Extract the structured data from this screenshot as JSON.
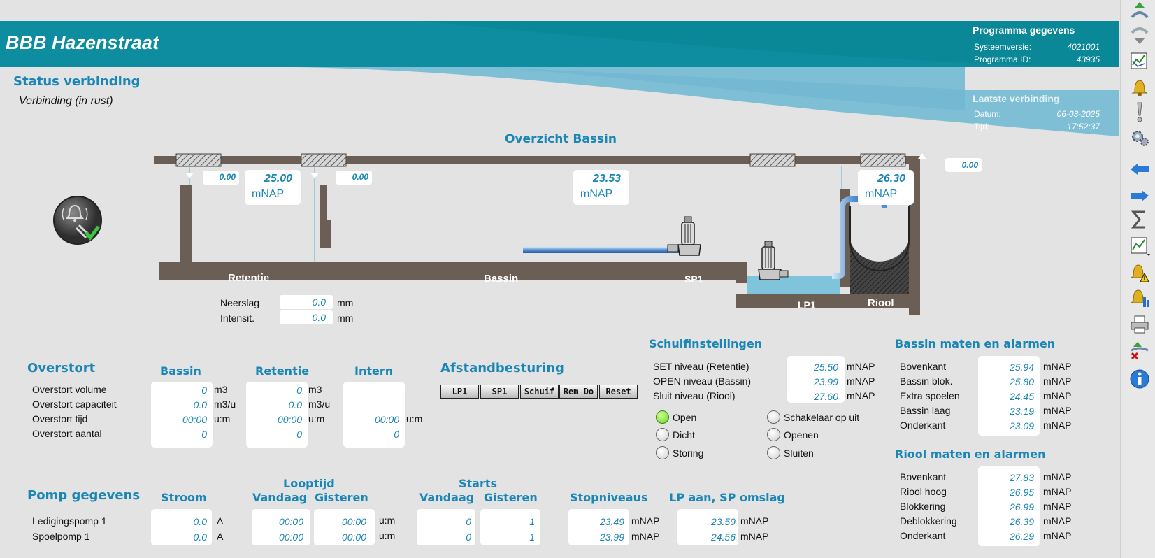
{
  "header": {
    "title": "BBB Hazenstraat"
  },
  "program": {
    "heading": "Programma gegevens",
    "sys_label": "Systeemversie:",
    "sys_value": "4021001",
    "id_label": "Programma ID:",
    "id_value": "43935"
  },
  "last_conn": {
    "heading": "Laatste verbinding",
    "date_label": "Datum:",
    "date_value": "06-03-2025",
    "time_label": "Tijd:",
    "time_value": "17:52:37"
  },
  "status": {
    "heading": "Status verbinding",
    "value": "Verbinding (in rust)"
  },
  "overview": {
    "title": "Overzicht Bassin",
    "retentie_level": "25.00",
    "bassin_level": "23.53",
    "riool_level": "26.30",
    "unit": "mNAP",
    "flow1": "0.00",
    "flow2": "0.00",
    "flow3": "0.00",
    "label_retentie": "Retentie",
    "label_bassin": "Bassin",
    "label_sp1": "SP1",
    "label_lp1": "LP1",
    "label_riool": "Riool",
    "neerslag_label": "Neerslag",
    "neerslag_value": "0.0",
    "intensit_label": "Intensit.",
    "intensit_value": "0.0",
    "mm": "mm"
  },
  "overstort": {
    "heading": "Overstort",
    "col_bassin": "Bassin",
    "col_retentie": "Retentie",
    "col_intern": "Intern",
    "rows": [
      {
        "label": "Overstort volume",
        "bassin": "0",
        "retentie": "0",
        "intern": "",
        "unit": "m3"
      },
      {
        "label": "Overstort capaciteit",
        "bassin": "0.0",
        "retentie": "0.0",
        "intern": "",
        "unit": "m3/u"
      },
      {
        "label": "Overstort tijd",
        "bassin": "00:00",
        "retentie": "00:00",
        "intern": "00:00",
        "unit": "u:m"
      },
      {
        "label": "Overstort aantal",
        "bassin": "0",
        "retentie": "0",
        "intern": "0",
        "unit": ""
      }
    ]
  },
  "remote": {
    "heading": "Afstandbesturing",
    "buttons": [
      "LP1",
      "SP1",
      "Schuif",
      "Rem Do",
      "Reset"
    ]
  },
  "schuif": {
    "heading": "Schuifinstellingen",
    "rows": [
      {
        "label": "SET niveau (Retentie)",
        "value": "25.50",
        "unit": "mNAP"
      },
      {
        "label": "OPEN niveau (Bassin)",
        "value": "23.99",
        "unit": "mNAP"
      },
      {
        "label": "Sluit niveau (Riool)",
        "value": "27.60",
        "unit": "mNAP"
      }
    ],
    "status_left": [
      "Open",
      "Dicht",
      "Storing"
    ],
    "status_right": [
      "Schakelaar op uit",
      "Openen",
      "Sluiten"
    ]
  },
  "bassin_alarms": {
    "heading": "Bassin maten en alarmen",
    "rows": [
      {
        "label": "Bovenkant",
        "value": "25.94",
        "unit": "mNAP"
      },
      {
        "label": "Bassin blok.",
        "value": "25.80",
        "unit": "mNAP"
      },
      {
        "label": "Extra spoelen",
        "value": "24.45",
        "unit": "mNAP"
      },
      {
        "label": "Bassin laag",
        "value": "23.19",
        "unit": "mNAP"
      },
      {
        "label": "Onderkant",
        "value": "23.09",
        "unit": "mNAP"
      }
    ]
  },
  "riool_alarms": {
    "heading": "Riool maten en alarmen",
    "rows": [
      {
        "label": "Bovenkant",
        "value": "27.83",
        "unit": "mNAP"
      },
      {
        "label": "Riool hoog",
        "value": "26.95",
        "unit": "mNAP"
      },
      {
        "label": "Blokkering",
        "value": "26.99",
        "unit": "mNAP"
      },
      {
        "label": "Deblokkering",
        "value": "26.39",
        "unit": "mNAP"
      },
      {
        "label": "Onderkant",
        "value": "26.29",
        "unit": "mNAP"
      }
    ]
  },
  "pomp": {
    "heading": "Pomp gegevens",
    "col_stroom": "Stroom",
    "col_looptijd": "Looptijd",
    "col_starts": "Starts",
    "col_vandaag": "Vandaag",
    "col_gisteren": "Gisteren",
    "col_stop": "Stopniveaus",
    "col_lp": "LP aan, SP omslag",
    "unit_a": "A",
    "unit_um": "u:m",
    "unit_mnap": "mNAP",
    "rows": [
      {
        "label": "Ledigingspomp 1",
        "stroom": "0.0",
        "lt_vandaag": "00:00",
        "lt_gisteren": "00:00",
        "st_vandaag": "0",
        "st_gisteren": "1",
        "stop": "23.49",
        "lp": "23.59"
      },
      {
        "label": "Spoelpomp 1",
        "stroom": "0.0",
        "lt_vandaag": "00:00",
        "lt_gisteren": "00:00",
        "st_vandaag": "0",
        "st_gisteren": "1",
        "stop": "23.99",
        "lp": "24.56"
      }
    ]
  },
  "sidebar_icons": [
    "arrow-up-icon",
    "arrow-down-icon",
    "trend-icon",
    "bell-icon",
    "exclamation-icon",
    "gears-icon",
    "arrow-left-icon",
    "arrow-right-icon",
    "sigma-icon",
    "trend2-icon",
    "bell-warning-icon",
    "bell-info-icon",
    "printer-icon",
    "user-remove-icon",
    "info-icon"
  ]
}
